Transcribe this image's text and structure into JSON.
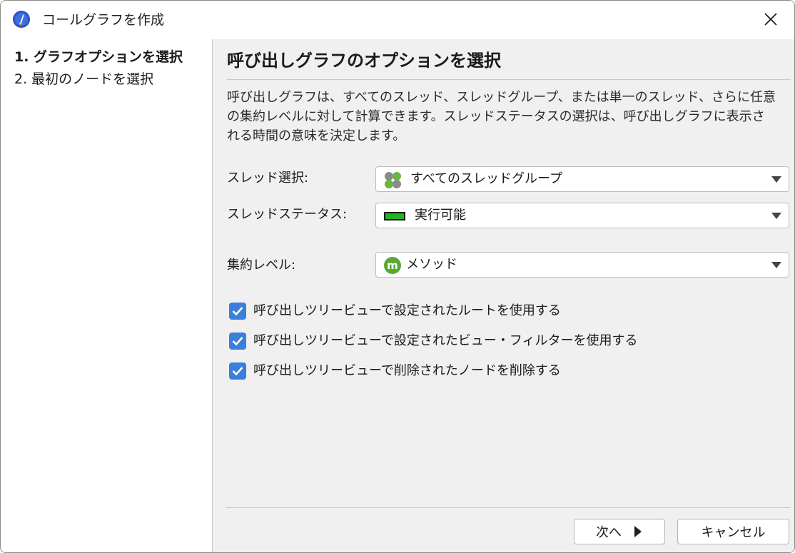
{
  "window": {
    "title": "コールグラフを作成"
  },
  "steps": [
    {
      "label": "1. グラフオプションを選択",
      "active": true
    },
    {
      "label": "2. 最初のノードを選択",
      "active": false
    }
  ],
  "main": {
    "heading": "呼び出しグラフのオプションを選択",
    "description": "呼び出しグラフは、すべてのスレッド、スレッドグループ、または単一のスレッド、さらに任意の集約レベルに対して計算できます。スレッドステータスの選択は、呼び出しグラフに表示される時間の意味を決定します。",
    "fields": {
      "thread_selection": {
        "label": "スレッド選択:",
        "value": "すべてのスレッドグループ",
        "icon": "thread-groups-icon"
      },
      "thread_status": {
        "label": "スレッドステータス:",
        "value": "実行可能",
        "icon": "runnable-status-icon",
        "color": "#22b322"
      },
      "aggregation": {
        "label": "集約レベル:",
        "value": "メソッド",
        "icon": "method-icon",
        "color": "#5aa832"
      }
    },
    "checkboxes": [
      {
        "label": "呼び出しツリービューで設定されたルートを使用する",
        "checked": true
      },
      {
        "label": "呼び出しツリービューで設定されたビュー・フィルターを使用する",
        "checked": true
      },
      {
        "label": "呼び出しツリービューで削除されたノードを削除する",
        "checked": true
      }
    ]
  },
  "buttons": {
    "next": "次へ",
    "cancel": "キャンセル"
  },
  "colors": {
    "accent": "#3b7fd9",
    "background": "#f0f0f0"
  }
}
